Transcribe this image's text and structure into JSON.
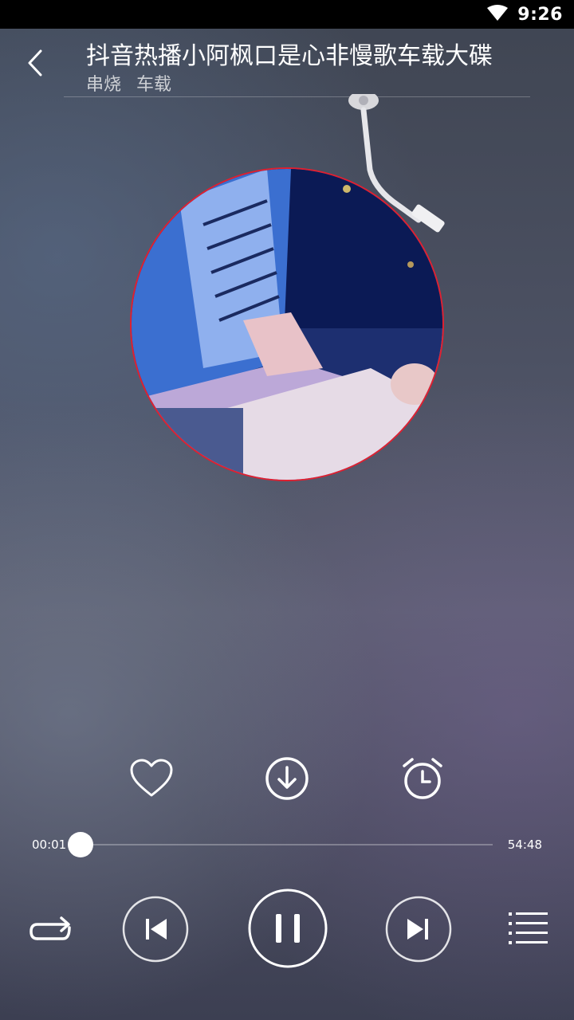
{
  "status_bar": {
    "time": "9:26",
    "icons": [
      "wifi-icon"
    ]
  },
  "header": {
    "back_icon": "chevron-left-icon",
    "title": "抖音热播小阿枫口是心非慢歌车载大碟",
    "tags": [
      "串烧",
      "车载"
    ]
  },
  "player": {
    "disc_border_color": "#e02030",
    "actions": [
      "heart-icon",
      "download-icon",
      "alarm-clock-icon"
    ],
    "current_time": "00:01",
    "total_time": "54:48",
    "progress": 0.0003,
    "controls": [
      "repeat-icon",
      "previous-icon",
      "pause-icon",
      "next-icon",
      "playlist-icon"
    ]
  }
}
